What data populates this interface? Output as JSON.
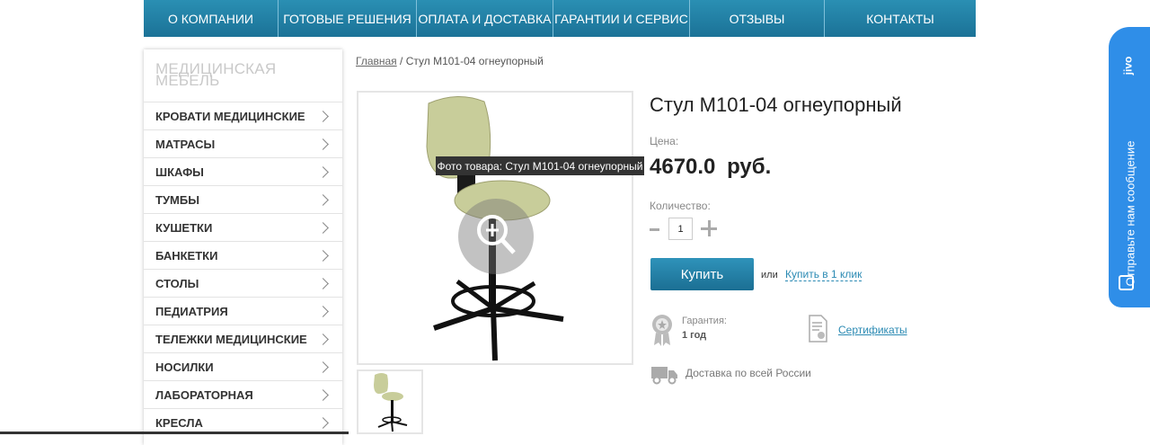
{
  "nav": {
    "items": [
      "О КОМПАНИИ",
      "ГОТОВЫЕ РЕШЕНИЯ",
      "ОПЛАТА И ДОСТАВКА",
      "ГАРАНТИИ И СЕРВИС",
      "ОТЗЫВЫ",
      "КОНТАКТЫ"
    ]
  },
  "sidebar": {
    "title_line1": "МЕДИЦИНСКАЯ",
    "title_line2": "МЕБЕЛЬ",
    "items": [
      "КРОВАТИ МЕДИЦИНСКИЕ",
      "МАТРАСЫ",
      "ШКАФЫ",
      "ТУМБЫ",
      "КУШЕТКИ",
      "БАНКЕТКИ",
      "СТОЛЫ",
      "ПЕДИАТРИЯ",
      "ТЕЛЕЖКИ МЕДИЦИНСКИЕ",
      "НОСИЛКИ",
      "ЛАБОРАТОРНАЯ",
      "КРЕСЛА"
    ]
  },
  "breadcrumb": {
    "home": "Главная",
    "separator": "/",
    "current": "Стул М101-04 огнеупорный"
  },
  "product": {
    "title": "Стул М101-04 огнеупорный",
    "tooltip": "Фото товара: Стул М101-04 огнеупорный",
    "price_label": "Цена:",
    "price": "4670.0  руб.",
    "qty_label": "Количество:",
    "qty_value": "1",
    "buy_label": "Купить",
    "or_label": "или",
    "one_click_label": "Купить в 1 клик",
    "warranty_label": "Гарантия:",
    "warranty_value": "1 год",
    "certificates_label": "Сертификаты",
    "delivery_label": "Доставка по всей России"
  },
  "chat": {
    "logo": "jivo",
    "label": "Отправьте нам сообщение"
  },
  "colors": {
    "nav_blue": "#1f7ea6",
    "link_blue": "#2b8ab3",
    "chat_blue": "#2f8ee8",
    "chair_green": "#c8cd9a"
  }
}
